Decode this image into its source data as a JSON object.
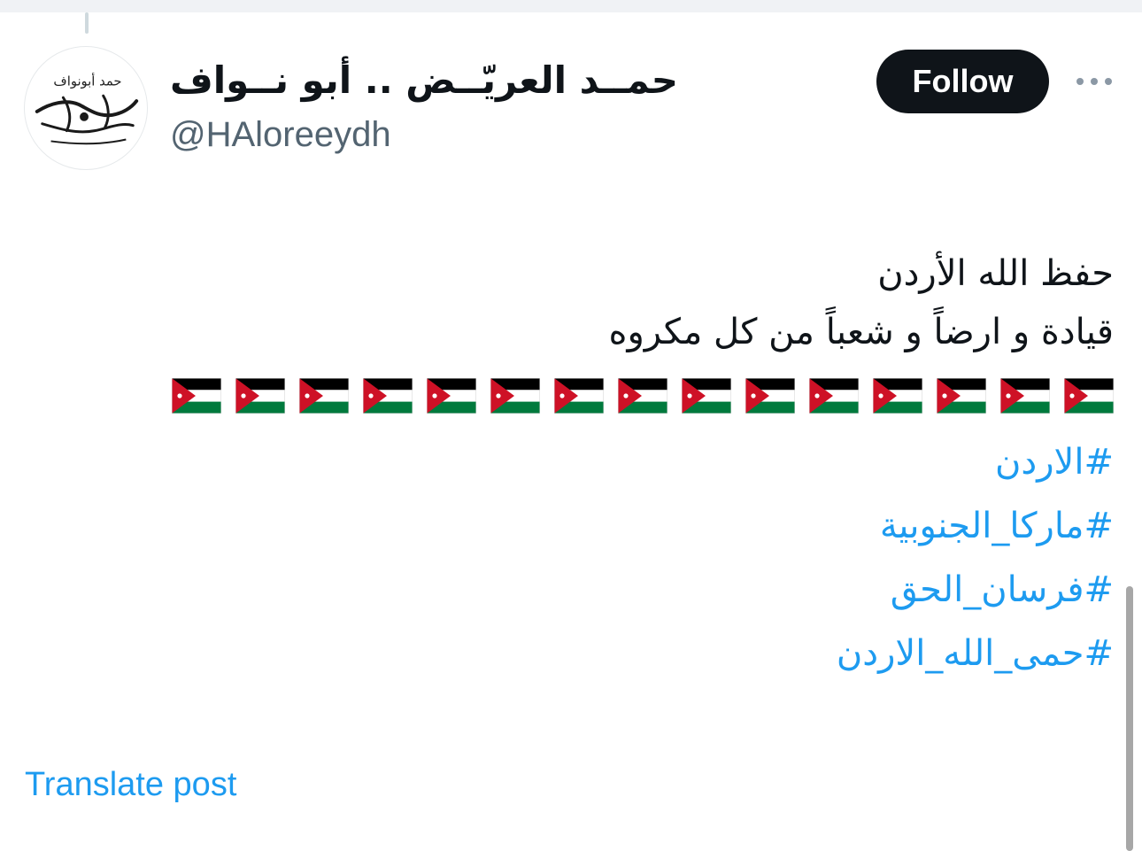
{
  "post": {
    "author": {
      "display_name": "حمــد العريّــض .. أبو نــواف",
      "handle": "@HAloreeydh",
      "avatar_text": "حمد أبونواف"
    },
    "follow_label": "Follow",
    "text_lines": [
      "حفظ الله الأردن",
      "قيادة و ارضاً و شعباً من كل مكروه"
    ],
    "flag_emoji_count": 15,
    "hashtags": [
      "#الاردن",
      "#ماركا_الجنوبية",
      "#فرسان_الحق",
      "#حمى_الله_الاردن"
    ],
    "translate_label": "Translate post"
  },
  "colors": {
    "link": "#1d9bf0",
    "button_bg": "#0f1419",
    "handle": "#536471",
    "flag_black": "#000000",
    "flag_white": "#ffffff",
    "flag_green": "#007a3d",
    "flag_red": "#ce1126"
  },
  "icons": {
    "more": "more-horizontal-icon",
    "flag": "jordan-flag-icon"
  }
}
